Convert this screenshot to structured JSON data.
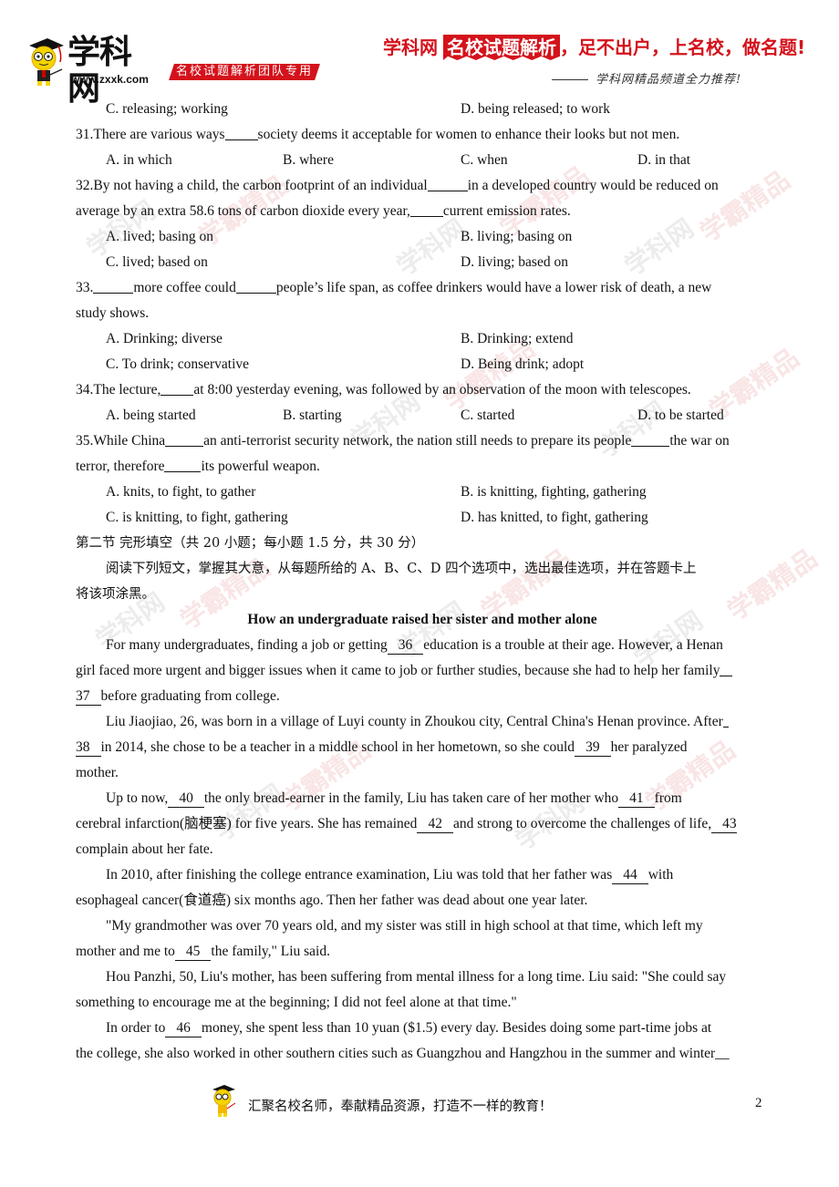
{
  "header": {
    "logo_title": "学科网",
    "logo_url": "www.zxxk.com",
    "team_badge": "名校试题解析团队专用",
    "slogan_brand": "学科网",
    "slogan_boxed": "名校试题解析",
    "slogan_rest": "，足不出户，上名校，做名题!",
    "recommend": "学科网精品频道全力推荐!",
    "brand_color": "#d4121b"
  },
  "questions": {
    "q30_options": {
      "C": "C. releasing; working",
      "D": "D. being released; to work"
    },
    "q31": {
      "stem_pre": "31.There are various ways",
      "stem_post": "society deems it acceptable for women to enhance their looks but not men.",
      "options": [
        "A. in which",
        "B. where",
        "C. when",
        "D. in that"
      ]
    },
    "q32": {
      "stem1_pre": "32.By not having a child, the carbon footprint of an individual",
      "stem1_post": "in a developed country would be reduced on",
      "stem2_pre": "average by an extra 58.6 tons of carbon dioxide every year,",
      "stem2_post": "current emission rates.",
      "options": [
        "A. lived; basing on",
        "B. living; basing on",
        "C. lived; based on",
        "D. living; based on"
      ]
    },
    "q33": {
      "stem_a": "33.",
      "stem_b": "more coffee could",
      "stem_c": "people’s life span, as coffee drinkers would have a lower risk of death, a new",
      "stem2": "study shows.",
      "options": [
        "A. Drinking; diverse",
        "B. Drinking; extend",
        "C. To drink; conservative",
        "D. Being drink; adopt"
      ]
    },
    "q34": {
      "stem_pre": "34.The lecture,",
      "stem_post": "at 8:00 yesterday evening, was followed by an observation of the moon with telescopes.",
      "options": [
        "A. being started",
        "B. starting",
        "C. started",
        "D. to be started"
      ]
    },
    "q35": {
      "stem1_a": "35.While China",
      "stem1_b": "an anti-terrorist security network, the nation still needs to prepare its people",
      "stem1_c": "the war on",
      "stem2_a": "terror, therefore",
      "stem2_b": "its powerful weapon.",
      "options": [
        "A. knits, to fight, to gather",
        "B. is knitting, fighting, gathering",
        "C. is knitting, to fight, gathering",
        "D. has knitted, to fight, gathering"
      ]
    }
  },
  "section2": {
    "heading": "第二节  完形填空（共 20 小题；每小题 1.5 分，共 30 分）",
    "instruction1": "阅读下列短文，掌握其大意，从每题所给的 A、B、C、D 四个选项中，选出最佳选项，并在答题卡上",
    "instruction2": "将该项涂黑。",
    "passage_title": "How an undergraduate raised her sister and mother alone"
  },
  "passage": {
    "p1_l1_pre": "For many undergraduates, finding a job or getting",
    "b36": "36",
    "p1_l1_post": "education is a trouble at their age. However, a Henan",
    "p1_l2": "girl faced more urgent and bigger issues when it came to job or further studies, because she had to help her family",
    "b37": "37",
    "p1_l3_post": "before graduating from college.",
    "p2_l1": "Liu Jiaojiao, 26, was born in a village of Luyi county in Zhoukou city, Central China's Henan province. After",
    "b38": "38",
    "p2_l2_mid": "in 2014, she chose to be a teacher in a middle school in her hometown, so she could",
    "b39": "39",
    "p2_l2_post": "her paralyzed",
    "p2_l3": "mother.",
    "p3_l1_pre": "Up to now,",
    "b40": "40",
    "p3_l1_mid": "the only bread-earner in the family, Liu has taken care of her mother who",
    "b41": "41",
    "p3_l1_post": "from",
    "p3_l2_pre": "cerebral infarction(脑梗塞) for five years. She has remained",
    "b42": "42",
    "p3_l2_mid": "and strong to overcome the challenges of life,",
    "b43": "43",
    "p3_l3": "complain about her fate.",
    "p4_l1_pre": "In 2010, after finishing the college entrance examination, Liu was told that her father was",
    "b44": "44",
    "p4_l1_post": "with",
    "p4_l2": "esophageal cancer(食道癌) six months ago. Then her father was dead about one year later.",
    "p5_l1": "\"My grandmother was over 70 years old, and my sister was still in high school at that time, which left my",
    "p5_l2_pre": "mother and me to",
    "b45": "45",
    "p5_l2_post": "the family,\" Liu said.",
    "p6_l1": "Hou Panzhi, 50, Liu's mother, has been suffering from mental illness for a long time. Liu said: \"She could say",
    "p6_l2": "something to encourage me at the beginning; I did not feel alone at that time.\"",
    "p7_l1_pre": "In order to",
    "b46": "46",
    "p7_l1_post": "money, she spent less than 10 yuan ($1.5) every day. Besides doing some part-time jobs at",
    "p7_l2": "the college, she also worked in other southern cities such as Guangzhou and Hangzhou in the summer and winter__"
  },
  "footer": {
    "slogan": "汇聚名校名师，奉献精品资源，打造不一样的教育！",
    "page_number": "2"
  }
}
